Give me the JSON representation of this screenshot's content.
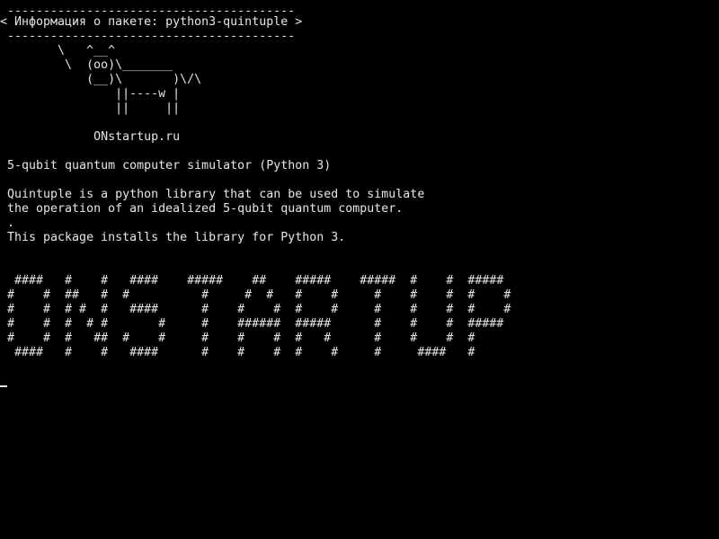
{
  "terminal": {
    "lines": [
      " ----------------------------------------",
      "< Информация о пакете: python3-quintuple >",
      " ----------------------------------------",
      "        \\   ^__^",
      "         \\  (oo)\\_______",
      "            (__)\\       )\\/\\",
      "                ||----w |",
      "                ||     ||",
      "",
      "             ONstartup.ru",
      "",
      " 5-qubit quantum computer simulator (Python 3)",
      "",
      " Quintuple is a python library that can be used to simulate",
      " the operation of an idealized 5-qubit quantum computer.",
      " .",
      " This package installs the library for Python 3.",
      "",
      "",
      "  ####   #    #   ####    #####    ##    #####    #####  #    #  #####",
      " #    #  ##   #  #          #     #  #   #    #     #    #    #  #    #",
      " #    #  # #  #   ####      #    #    #  #    #     #    #    #  #    #",
      " #    #  #  # #       #     #    ######  #####      #    #    #  #####",
      " #    #  #   ##  #    #     #    #    #  #   #      #    #    #  #",
      "  ####   #    #   ####      #    #    #  #    #     #     ####   #"
    ],
    "colors": {
      "background": "#000000",
      "foreground": "#e6e6e6"
    }
  }
}
